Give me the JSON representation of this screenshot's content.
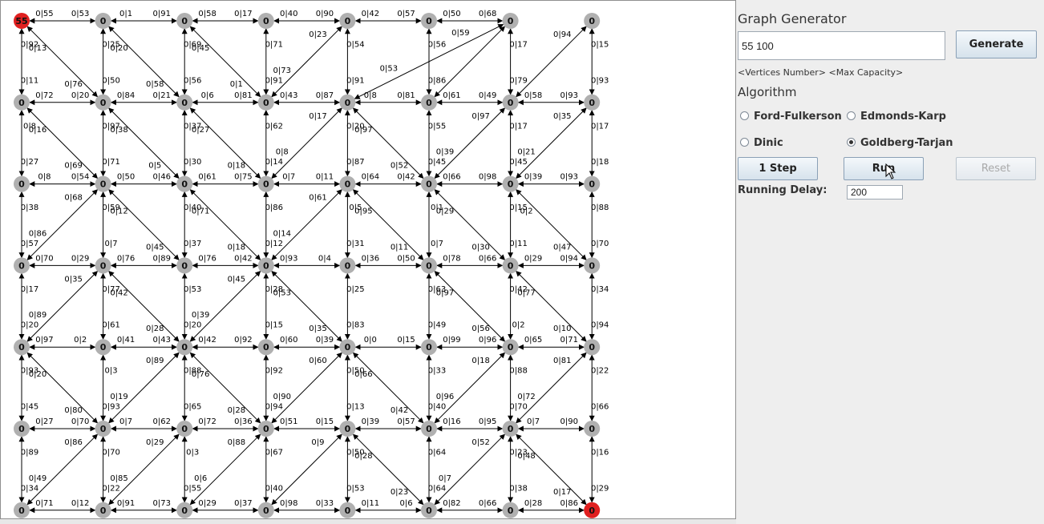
{
  "panel": {
    "title": "Graph Generator",
    "generator_input": "55 100",
    "generate_button": "Generate",
    "hint": "<Vertices Number> <Max Capacity>",
    "algorithm_heading": "Algorithm",
    "algorithms": [
      {
        "label": "Ford-Fulkerson",
        "selected": false
      },
      {
        "label": "Edmonds-Karp",
        "selected": false
      },
      {
        "label": "Dinic",
        "selected": false
      },
      {
        "label": "Goldberg-Tarjan",
        "selected": true
      }
    ],
    "step_button": "1 Step",
    "run_button": "Run",
    "reset_button": "Reset",
    "delay_label": "Running Delay:",
    "delay_value": "200"
  },
  "graph": {
    "colors": {
      "node": "#b0b0b0",
      "terminal": "#e02020",
      "edge": "#000000",
      "text": "#000000"
    },
    "rows": 7,
    "cols": 8,
    "nodes": [
      [
        "55",
        "0",
        "0",
        "0",
        "0",
        "0",
        "0",
        "0"
      ],
      [
        "0",
        "0",
        "0",
        "0",
        "0",
        "0",
        "0",
        "0"
      ],
      [
        "0",
        "0",
        "0",
        "0",
        "0",
        "0",
        "0",
        "0"
      ],
      [
        "0",
        "0",
        "0",
        "0",
        "0",
        "0",
        "0",
        "0"
      ],
      [
        "0",
        "0",
        "0",
        "0",
        "0",
        "0",
        "0",
        "0"
      ],
      [
        "0",
        "0",
        "0",
        "0",
        "0",
        "0",
        "0",
        "0"
      ],
      [
        "0",
        "0",
        "0",
        "0",
        "0",
        "0",
        "0",
        "0"
      ]
    ],
    "terminals": [
      [
        0,
        0
      ],
      [
        6,
        7
      ]
    ],
    "horizontal_edges": [
      [
        [
          "0|55",
          "0|53"
        ],
        [
          "0|1",
          "0|91"
        ],
        [
          "0|58",
          "0|17"
        ],
        [
          "0|40",
          "0|90"
        ],
        [
          "0|42",
          "0|57"
        ],
        [
          "0|50",
          "0|68"
        ]
      ],
      [
        [
          "0|72",
          "0|20"
        ],
        [
          "0|84",
          "0|21"
        ],
        [
          "0|6",
          "0|81"
        ],
        [
          "0|43",
          "0|87"
        ],
        [
          "0|8",
          "0|81"
        ],
        [
          "0|61",
          "0|49"
        ],
        [
          "0|58",
          "0|93"
        ]
      ],
      [
        [
          "0|8",
          "0|54"
        ],
        [
          "0|50",
          "0|46"
        ],
        [
          "0|61",
          "0|75"
        ],
        [
          "0|7",
          "0|11"
        ],
        [
          "0|64",
          "0|42"
        ],
        [
          "0|66",
          "0|98"
        ],
        [
          "0|39",
          "0|93"
        ]
      ],
      [
        [
          "0|70",
          "0|29"
        ],
        [
          "0|76",
          "0|89"
        ],
        [
          "0|76",
          "0|42"
        ],
        [
          "0|93",
          "0|4"
        ],
        [
          "0|36",
          "0|50"
        ],
        [
          "0|78",
          "0|66"
        ],
        [
          "0|29",
          "0|94"
        ]
      ],
      [
        [
          "0|97",
          "0|2"
        ],
        [
          "0|41",
          "0|43"
        ],
        [
          "0|42",
          "0|92"
        ],
        [
          "0|60",
          "0|39"
        ],
        [
          "0|0",
          "0|15"
        ],
        [
          "0|99",
          "0|96"
        ],
        [
          "0|65",
          "0|71"
        ]
      ],
      [
        [
          "0|27",
          "0|70"
        ],
        [
          "0|7",
          "0|62"
        ],
        [
          "0|72",
          "0|36"
        ],
        [
          "0|51",
          "0|15"
        ],
        [
          "0|39",
          "0|57"
        ],
        [
          "0|16",
          "0|95"
        ],
        [
          "0|7",
          "0|90"
        ]
      ],
      [
        [
          "0|71",
          "0|12"
        ],
        [
          "0|91",
          "0|73"
        ],
        [
          "0|29",
          "0|37"
        ],
        [
          "0|98",
          "0|33"
        ],
        [
          "0|11",
          "0|6"
        ],
        [
          "0|82",
          "0|66"
        ],
        [
          "0|28",
          "0|86"
        ]
      ]
    ],
    "vertical_edges": [
      [
        [
          "0|92",
          "0|11"
        ],
        [
          "0|25",
          "0|50"
        ],
        [
          "0|69",
          "0|56"
        ],
        [
          "0|71",
          "0|91"
        ],
        [
          "0|54",
          "0|91"
        ],
        [
          "0|56",
          "0|86"
        ],
        [
          "0|17",
          "0|79"
        ],
        [
          "0|15",
          "0|93"
        ]
      ],
      [
        [
          "0|8",
          "0|27"
        ],
        [
          "0|97",
          "0|71"
        ],
        [
          "0|37",
          "0|30"
        ],
        [
          "0|62",
          "0|14"
        ],
        [
          "0|20",
          "0|87"
        ],
        [
          "0|55",
          "0|45"
        ],
        [
          "0|17",
          "0|45"
        ],
        [
          "0|17",
          "0|18"
        ]
      ],
      [
        [
          "0|38",
          "0|57"
        ],
        [
          "0|59",
          "0|7"
        ],
        [
          "0|40",
          "0|37"
        ],
        [
          "0|86",
          "0|12"
        ],
        [
          "0|5",
          "0|31"
        ],
        [
          "0|1",
          "0|7"
        ],
        [
          "0|15",
          "0|11"
        ],
        [
          "0|88",
          "0|70"
        ]
      ],
      [
        [
          "0|17",
          "0|20"
        ],
        [
          "0|77",
          "0|61"
        ],
        [
          "0|53",
          "0|20"
        ],
        [
          "0|28",
          "0|15"
        ],
        [
          "0|25",
          "0|83"
        ],
        [
          "0|63",
          "0|49"
        ],
        [
          "0|42",
          "0|2"
        ],
        [
          "0|34",
          "0|94"
        ]
      ],
      [
        [
          "0|93",
          "0|45"
        ],
        [
          "0|3",
          "0|93"
        ],
        [
          "0|88",
          "0|65"
        ],
        [
          "0|92",
          "0|94"
        ],
        [
          "0|50",
          "0|13"
        ],
        [
          "0|33",
          "0|40"
        ],
        [
          "0|88",
          "0|70"
        ],
        [
          "0|22",
          "0|66"
        ]
      ],
      [
        [
          "0|89",
          "0|34"
        ],
        [
          "0|70",
          "0|22"
        ],
        [
          "0|3",
          "0|55"
        ],
        [
          "0|67",
          "0|40"
        ],
        [
          "0|50",
          "0|53"
        ],
        [
          "0|64",
          "0|64"
        ],
        [
          "0|23",
          "0|38"
        ],
        [
          "0|16",
          "0|29"
        ]
      ]
    ],
    "diagonal_edges": [
      {
        "from": [
          0,
          0
        ],
        "to": [
          1,
          1
        ],
        "labels": [
          "0|13",
          "0|76"
        ]
      },
      {
        "from": [
          0,
          1
        ],
        "to": [
          1,
          2
        ],
        "labels": [
          "0|20",
          "0|58"
        ]
      },
      {
        "from": [
          0,
          2
        ],
        "to": [
          1,
          3
        ],
        "labels": [
          "0|45",
          "0|1"
        ]
      },
      {
        "from": [
          0,
          4
        ],
        "to": [
          1,
          3
        ],
        "labels": [
          "0|23",
          "0|73"
        ]
      },
      {
        "from": [
          0,
          6
        ],
        "to": [
          1,
          4
        ],
        "labels": [
          "0|59",
          "0|53"
        ]
      },
      {
        "from": [
          0,
          6
        ],
        "to": [
          1,
          5
        ],
        "labels": [
          "",
          ""
        ]
      },
      {
        "from": [
          0,
          7
        ],
        "to": [
          1,
          6
        ],
        "labels": [
          "0|94",
          ""
        ]
      },
      {
        "from": [
          1,
          0
        ],
        "to": [
          2,
          1
        ],
        "labels": [
          "0|16",
          "0|69"
        ]
      },
      {
        "from": [
          1,
          1
        ],
        "to": [
          2,
          2
        ],
        "labels": [
          "0|38",
          "0|5"
        ]
      },
      {
        "from": [
          1,
          2
        ],
        "to": [
          2,
          3
        ],
        "labels": [
          "0|27",
          "0|18"
        ]
      },
      {
        "from": [
          1,
          4
        ],
        "to": [
          2,
          3
        ],
        "labels": [
          "0|17",
          "0|8"
        ]
      },
      {
        "from": [
          1,
          4
        ],
        "to": [
          2,
          5
        ],
        "labels": [
          "0|97",
          "0|52"
        ]
      },
      {
        "from": [
          1,
          6
        ],
        "to": [
          2,
          5
        ],
        "labels": [
          "0|97",
          "0|39"
        ]
      },
      {
        "from": [
          1,
          7
        ],
        "to": [
          2,
          6
        ],
        "labels": [
          "0|35",
          "0|21"
        ]
      },
      {
        "from": [
          2,
          1
        ],
        "to": [
          3,
          0
        ],
        "labels": [
          "0|68",
          "0|86"
        ]
      },
      {
        "from": [
          2,
          1
        ],
        "to": [
          3,
          2
        ],
        "labels": [
          "0|12",
          "0|45"
        ]
      },
      {
        "from": [
          2,
          2
        ],
        "to": [
          3,
          3
        ],
        "labels": [
          "0|71",
          "0|18"
        ]
      },
      {
        "from": [
          2,
          4
        ],
        "to": [
          3,
          3
        ],
        "labels": [
          "0|61",
          "0|14"
        ]
      },
      {
        "from": [
          2,
          4
        ],
        "to": [
          3,
          5
        ],
        "labels": [
          "0|95",
          "0|11"
        ]
      },
      {
        "from": [
          2,
          5
        ],
        "to": [
          3,
          6
        ],
        "labels": [
          "0|29",
          "0|30"
        ]
      },
      {
        "from": [
          2,
          6
        ],
        "to": [
          3,
          7
        ],
        "labels": [
          "0|2",
          "0|47"
        ]
      },
      {
        "from": [
          3,
          1
        ],
        "to": [
          4,
          0
        ],
        "labels": [
          "0|35",
          "0|89"
        ]
      },
      {
        "from": [
          3,
          1
        ],
        "to": [
          4,
          2
        ],
        "labels": [
          "0|42",
          "0|28"
        ]
      },
      {
        "from": [
          3,
          3
        ],
        "to": [
          4,
          2
        ],
        "labels": [
          "0|45",
          "0|39"
        ]
      },
      {
        "from": [
          3,
          3
        ],
        "to": [
          4,
          4
        ],
        "labels": [
          "0|53",
          "0|35"
        ]
      },
      {
        "from": [
          3,
          5
        ],
        "to": [
          4,
          6
        ],
        "labels": [
          "0|97",
          "0|56"
        ]
      },
      {
        "from": [
          3,
          6
        ],
        "to": [
          4,
          7
        ],
        "labels": [
          "0|77",
          "0|10"
        ]
      },
      {
        "from": [
          4,
          0
        ],
        "to": [
          5,
          1
        ],
        "labels": [
          "0|20",
          "0|80"
        ]
      },
      {
        "from": [
          4,
          2
        ],
        "to": [
          5,
          1
        ],
        "labels": [
          "0|89",
          "0|19"
        ]
      },
      {
        "from": [
          4,
          2
        ],
        "to": [
          5,
          3
        ],
        "labels": [
          "0|76",
          "0|28"
        ]
      },
      {
        "from": [
          4,
          4
        ],
        "to": [
          5,
          3
        ],
        "labels": [
          "0|60",
          "0|90"
        ]
      },
      {
        "from": [
          4,
          4
        ],
        "to": [
          5,
          5
        ],
        "labels": [
          "0|66",
          "0|42"
        ]
      },
      {
        "from": [
          4,
          6
        ],
        "to": [
          5,
          5
        ],
        "labels": [
          "0|18",
          "0|96"
        ]
      },
      {
        "from": [
          4,
          7
        ],
        "to": [
          5,
          6
        ],
        "labels": [
          "0|81",
          "0|72"
        ]
      },
      {
        "from": [
          5,
          1
        ],
        "to": [
          6,
          0
        ],
        "labels": [
          "0|86",
          "0|49"
        ]
      },
      {
        "from": [
          5,
          2
        ],
        "to": [
          6,
          1
        ],
        "labels": [
          "0|29",
          "0|85"
        ]
      },
      {
        "from": [
          5,
          3
        ],
        "to": [
          6,
          2
        ],
        "labels": [
          "0|88",
          "0|6"
        ]
      },
      {
        "from": [
          5,
          4
        ],
        "to": [
          6,
          3
        ],
        "labels": [
          "0|9",
          ""
        ]
      },
      {
        "from": [
          5,
          4
        ],
        "to": [
          6,
          5
        ],
        "labels": [
          "0|28",
          "0|23"
        ]
      },
      {
        "from": [
          5,
          6
        ],
        "to": [
          6,
          5
        ],
        "labels": [
          "0|52",
          "0|7"
        ]
      },
      {
        "from": [
          5,
          6
        ],
        "to": [
          6,
          7
        ],
        "labels": [
          "0|48",
          "0|17"
        ]
      }
    ]
  }
}
